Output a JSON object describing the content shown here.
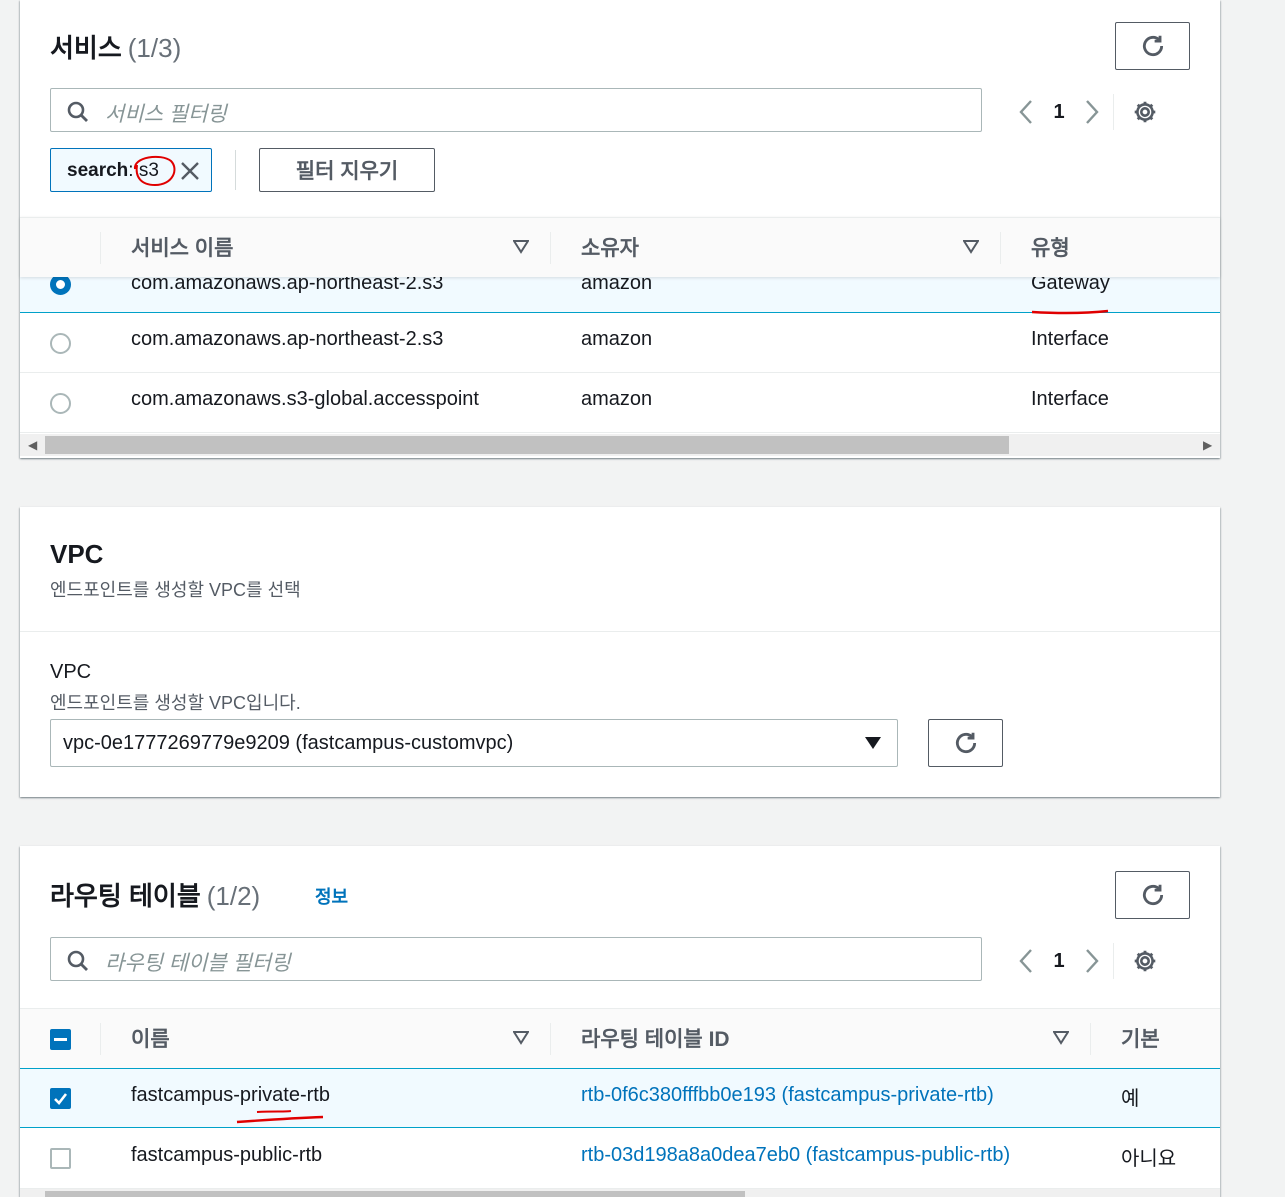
{
  "services_panel": {
    "title": "서비스",
    "count": "(1/3)",
    "search_placeholder": "서비스 필터링",
    "page": "1",
    "token_key": "search",
    "token_value": ": s3",
    "clear_filter_label": "필터 지우기",
    "columns": [
      "서비스 이름",
      "소유자",
      "유형"
    ],
    "rows": [
      {
        "name": "com.amazonaws.ap-northeast-2.s3",
        "owner": "amazon",
        "type": "Gateway",
        "selected": true
      },
      {
        "name": "com.amazonaws.ap-northeast-2.s3",
        "owner": "amazon",
        "type": "Interface",
        "selected": false
      },
      {
        "name": "com.amazonaws.s3-global.accesspoint",
        "owner": "amazon",
        "type": "Interface",
        "selected": false
      }
    ]
  },
  "vpc_panel": {
    "title": "VPC",
    "subtitle": "엔드포인트를 생성할 VPC를 선택",
    "field_label": "VPC",
    "field_desc": "엔드포인트를 생성할 VPC입니다.",
    "selected_vpc": "vpc-0e1777269779e9209 (fastcampus-customvpc)"
  },
  "route_panel": {
    "title": "라우팅 테이블",
    "count": "(1/2)",
    "info": "정보",
    "search_placeholder": "라우팅 테이블 필터링",
    "page": "1",
    "columns": [
      "이름",
      "라우팅 테이블 ID",
      "기본"
    ],
    "rows": [
      {
        "name": "fastcampus-private-rtb",
        "id": "rtb-0f6c380fffbb0e193 (fastcampus-private-rtb)",
        "main": "예",
        "checked": true
      },
      {
        "name": "fastcampus-public-rtb",
        "id": "rtb-03d198a8a0dea7eb0 (fastcampus-public-rtb)",
        "main": "아니요",
        "checked": false
      }
    ]
  },
  "colors": {
    "accent": "#0073bb",
    "annotation": "#e00000"
  }
}
